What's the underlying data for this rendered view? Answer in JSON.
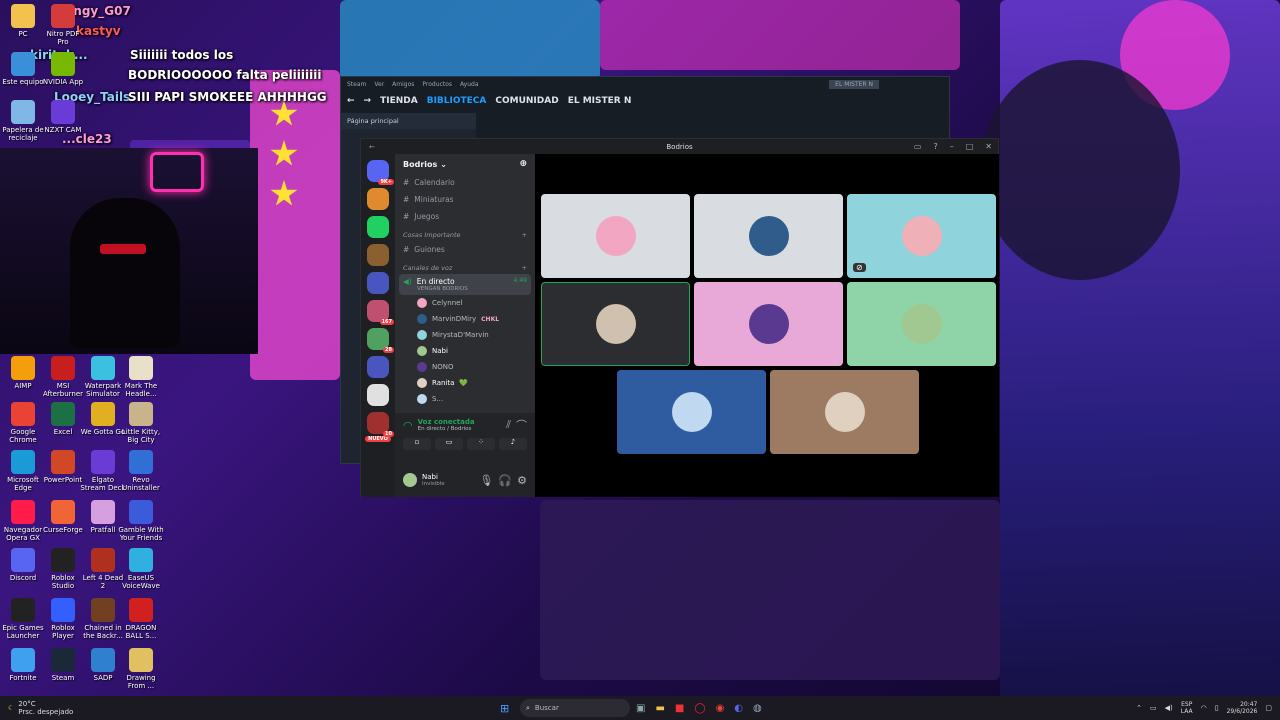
{
  "chat_overlay": {
    "lines": [
      {
        "user": "Angy_G07",
        "text": ""
      },
      {
        "user": "kastyv",
        "text": ""
      },
      {
        "user": "kiritak...",
        "text": "Siiiiiii todos los"
      },
      {
        "user": "",
        "text": "BODRIOOOOOO falta peliiiiiii"
      },
      {
        "user": "Looey_Tails",
        "text": "SIII PAPI SMOKEEE AHHHHGG"
      },
      {
        "user": "...cle23",
        "text": ""
      }
    ]
  },
  "desktop": {
    "icons": [
      {
        "label": "PC",
        "color": "#f2c14e"
      },
      {
        "label": "Nitro PDF Pro",
        "color": "#d43b3b"
      },
      {
        "label": "Este equipo",
        "color": "#3a8fd9"
      },
      {
        "label": "NVIDIA App",
        "color": "#76b900"
      },
      {
        "label": "Papelera de reciclaje",
        "color": "#7fb8e6"
      },
      {
        "label": "NZXT CAM",
        "color": "#6a3bd6"
      },
      {
        "label": "AIMP",
        "color": "#f59e0b"
      },
      {
        "label": "MSI Afterburner",
        "color": "#c81e1e"
      },
      {
        "label": "Waterpark Simulator",
        "color": "#3bc0e0"
      },
      {
        "label": "Mark The Headle...",
        "color": "#e8e0c8"
      },
      {
        "label": "Google Chrome",
        "color": "#ea4335"
      },
      {
        "label": "Excel",
        "color": "#1d7044"
      },
      {
        "label": "We Gotta Go",
        "color": "#e0b020"
      },
      {
        "label": "Little Kitty, Big City",
        "color": "#c9b38a"
      },
      {
        "label": "Microsoft Edge",
        "color": "#1a9ad6"
      },
      {
        "label": "PowerPoint",
        "color": "#d24726"
      },
      {
        "label": "Elgato Stream Deck",
        "color": "#6b3bd6"
      },
      {
        "label": "Revo Uninstaller",
        "color": "#2f6fd6"
      },
      {
        "label": "Navegador Opera GX",
        "color": "#ff1b4a"
      },
      {
        "label": "CurseForge",
        "color": "#f16436"
      },
      {
        "label": "Pratfall",
        "color": "#d6a0e0"
      },
      {
        "label": "Gamble With Your Friends",
        "color": "#3b5bdb"
      },
      {
        "label": "Discord",
        "color": "#5865f2"
      },
      {
        "label": "Roblox Studio",
        "color": "#222222"
      },
      {
        "label": "Left 4 Dead 2",
        "color": "#b03020"
      },
      {
        "label": "EaseUS VoiceWave",
        "color": "#2fb0e0"
      },
      {
        "label": "Epic Games Launcher",
        "color": "#222222"
      },
      {
        "label": "Roblox Player",
        "color": "#335fff"
      },
      {
        "label": "Chained in the Backr...",
        "color": "#704020"
      },
      {
        "label": "DRAGON BALL S...",
        "color": "#d02020"
      },
      {
        "label": "Fortnite",
        "color": "#3fa0f0"
      },
      {
        "label": "Steam",
        "color": "#1b2838"
      },
      {
        "label": "SADP",
        "color": "#3080d0"
      },
      {
        "label": "Drawing From ...",
        "color": "#e0c060"
      }
    ]
  },
  "steam": {
    "menu": [
      "Steam",
      "Ver",
      "Amigos",
      "Productos",
      "Ayuda"
    ],
    "nav": [
      "TIENDA",
      "BIBLIOTECA",
      "COMUNIDAD",
      "EL MISTER N"
    ],
    "active_nav": "BIBLIOTECA",
    "user": "EL MISTER N",
    "home": "Página principal"
  },
  "discord": {
    "window_title": "Bodrios",
    "server_name": "Bodrios",
    "guild_badges": [
      "9K+",
      "167",
      "28",
      "10",
      "NUEVO"
    ],
    "channels_top": [
      "Calendario",
      "Miniaturas",
      "Juegos"
    ],
    "category_important": "Cosas Importante",
    "channel_important": "Guiones",
    "category_voice": "Canales de voz",
    "live_channel": {
      "name": "En directo",
      "subtitle": "VENGAN BODRIOS",
      "timer": "4:49"
    },
    "voice_users": [
      {
        "name": "Celynnel",
        "tag": ""
      },
      {
        "name": "MarvinDMiry",
        "tag": "CHKL"
      },
      {
        "name": "MirystaD'Marvin",
        "tag": ""
      },
      {
        "name": "Nabi",
        "tag": ""
      },
      {
        "name": "NONO",
        "tag": ""
      },
      {
        "name": "Ranita",
        "tag": "💚"
      },
      {
        "name": "S...",
        "tag": ""
      }
    ],
    "voice_status": {
      "title": "Voz conectada",
      "subtitle": "En directo / Bodrios"
    },
    "user_panel": {
      "name": "Nabi",
      "status": "Invisible"
    },
    "tiles": [
      {
        "bg": "#d9dde2",
        "pic": "#f2a6c2"
      },
      {
        "bg": "#d9dde2",
        "pic": "#2f5c8a"
      },
      {
        "bg": "#8fd3dc",
        "pic": "#f0b0b8"
      },
      {
        "bg": "#2b2d30",
        "pic": "#d0c0b0"
      },
      {
        "bg": "#e8a8d8",
        "pic": "#5a3a90"
      },
      {
        "bg": "#8fd3a8",
        "pic": "#a0c890"
      },
      {
        "bg": "#2f5ba0",
        "pic": "#c0d8f0"
      },
      {
        "bg": "#9c7b62",
        "pic": "#e0d0c0"
      }
    ]
  },
  "taskbar": {
    "weather_temp": "20°C",
    "weather_text": "Prsc. despejado",
    "search_placeholder": "Buscar",
    "lang": "ESP",
    "lang2": "LAA",
    "time": "20:47",
    "date": "29/6/2026"
  }
}
